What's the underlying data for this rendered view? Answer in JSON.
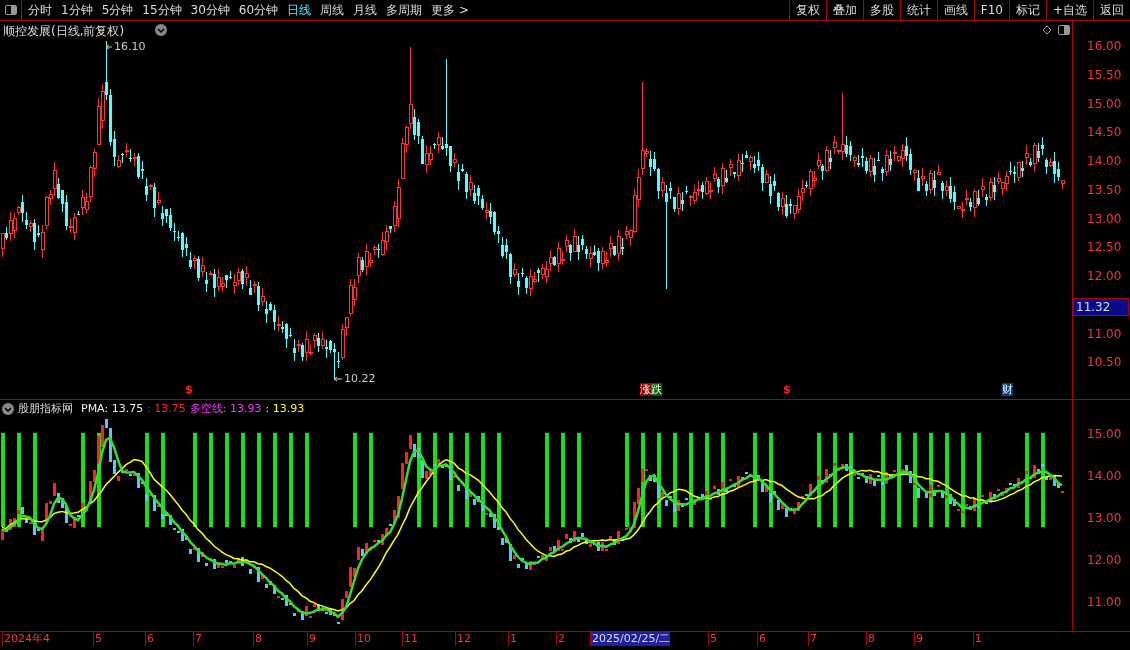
{
  "toolbar": {
    "periods": [
      {
        "label": "分时",
        "selected": false
      },
      {
        "label": "1分钟",
        "selected": false
      },
      {
        "label": "5分钟",
        "selected": false
      },
      {
        "label": "15分钟",
        "selected": false
      },
      {
        "label": "30分钟",
        "selected": false
      },
      {
        "label": "60分钟",
        "selected": false
      },
      {
        "label": "日线",
        "selected": true
      },
      {
        "label": "周线",
        "selected": false
      },
      {
        "label": "月线",
        "selected": false
      },
      {
        "label": "多周期",
        "selected": false
      },
      {
        "label": "更多 >",
        "selected": false
      }
    ],
    "buttons": [
      "复权",
      "叠加",
      "多股",
      "统计",
      "画线",
      "F10",
      "标记",
      "+自选",
      "返回"
    ]
  },
  "price_chart": {
    "title": "顺控发展(日线,前复权)",
    "high_label": "16.10",
    "low_label": "10.22",
    "axis_ticks": [
      "16.00",
      "15.50",
      "15.00",
      "14.50",
      "14.00",
      "13.50",
      "13.00",
      "12.50",
      "12.00",
      "11.00",
      "10.50"
    ],
    "current_price": "11.32",
    "markers": [
      {
        "label": "$",
        "kind": "dollar"
      },
      {
        "label": "涨",
        "kind": "rise"
      },
      {
        "label": "跌",
        "kind": "fall"
      },
      {
        "label": "$",
        "kind": "dollar"
      },
      {
        "label": "财",
        "kind": "finance"
      }
    ]
  },
  "indicator": {
    "name": "股朋指标网",
    "pma": "PMA: 13.75",
    "pma_value": ": 13.75",
    "trend": "多空线: 13.93",
    "trend_value": ": 13.93",
    "axis_ticks": [
      "15.00",
      "14.00",
      "13.00",
      "12.00",
      "11.00"
    ]
  },
  "date_axis": [
    {
      "label": "2024年4",
      "selected": false
    },
    {
      "label": "5",
      "selected": false
    },
    {
      "label": "6",
      "selected": false
    },
    {
      "label": "7",
      "selected": false
    },
    {
      "label": "8",
      "selected": false
    },
    {
      "label": "9",
      "selected": false
    },
    {
      "label": "10",
      "selected": false
    },
    {
      "label": "11",
      "selected": false
    },
    {
      "label": "12",
      "selected": false
    },
    {
      "label": "1",
      "selected": false
    },
    {
      "label": "2",
      "selected": false
    },
    {
      "label": "2025/02/25/二",
      "selected": true
    },
    {
      "label": "5",
      "selected": false
    },
    {
      "label": "6",
      "selected": false
    },
    {
      "label": "7",
      "selected": false
    },
    {
      "label": "8",
      "selected": false
    },
    {
      "label": "9",
      "selected": false
    },
    {
      "label": "1",
      "selected": false
    }
  ]
}
